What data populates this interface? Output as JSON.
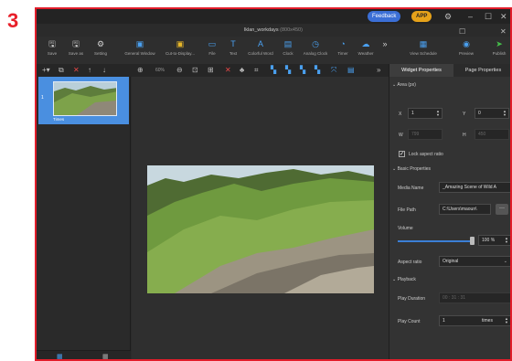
{
  "step_number": "3",
  "titlebar": {
    "feedback": "Feedback",
    "app": "APP"
  },
  "document": {
    "name": "lklan_workdays",
    "size": "(800x450)"
  },
  "toolbar": {
    "items": [
      {
        "label": "Save",
        "icon": "save-icon"
      },
      {
        "label": "Save as",
        "icon": "save-as-icon"
      },
      {
        "label": "Setting",
        "icon": "gear-icon"
      },
      {
        "label": "General Window",
        "icon": "window-icon"
      },
      {
        "label": "Cut-to-Display...",
        "icon": "cut-display-icon"
      },
      {
        "label": "File",
        "icon": "folder-icon"
      },
      {
        "label": "Text",
        "icon": "text-icon"
      },
      {
        "label": "Colorful Word",
        "icon": "colorful-word-icon"
      },
      {
        "label": "Clock",
        "icon": "clock-icon"
      },
      {
        "label": "Analog Clock",
        "icon": "analog-clock-icon"
      },
      {
        "label": "Timer",
        "icon": "timer-icon"
      },
      {
        "label": "Weather",
        "icon": "weather-icon"
      },
      {
        "label": "View Schedule",
        "icon": "calendar-icon"
      },
      {
        "label": "Preview",
        "icon": "eye-icon"
      },
      {
        "label": "Publish",
        "icon": "send-icon"
      }
    ]
  },
  "subbar": {
    "zoom": "60%"
  },
  "slides": [
    {
      "number": "1",
      "label": "Times"
    }
  ],
  "right_panel": {
    "tabs": [
      "Widget Properties",
      "Page Properties"
    ],
    "area": {
      "heading": "Area (px)",
      "x_label": "X",
      "x_value": "1",
      "y_label": "Y",
      "y_value": "0",
      "w_label": "W",
      "w_value": "799",
      "h_label": "H",
      "h_value": "450",
      "lock_label": "Lock aspect ratio",
      "lock_checked": true
    },
    "basic": {
      "heading": "Basic Properties",
      "media_name_label": "Media Name",
      "media_name_value": "_Amazing Scene of Wild A",
      "file_path_label": "File Path",
      "file_path_value": "C:\\Users\\maoun\\",
      "browse_label": "···",
      "volume_label": "Volume",
      "volume_value": "100 %",
      "volume_level": 1.0,
      "aspect_label": "Aspect ratio",
      "aspect_value": "Original"
    },
    "playback": {
      "heading": "Playback",
      "duration_label": "Play Duration",
      "duration_value": "00 : 31 : 31",
      "count_label": "Play Count",
      "count_value": "1",
      "count_unit": "times"
    }
  },
  "colors": {
    "accent": "#4a8fe0",
    "frame_border": "#e11d2a",
    "feedback": "#3b6fd6",
    "app_badge": "#e6a21a"
  }
}
